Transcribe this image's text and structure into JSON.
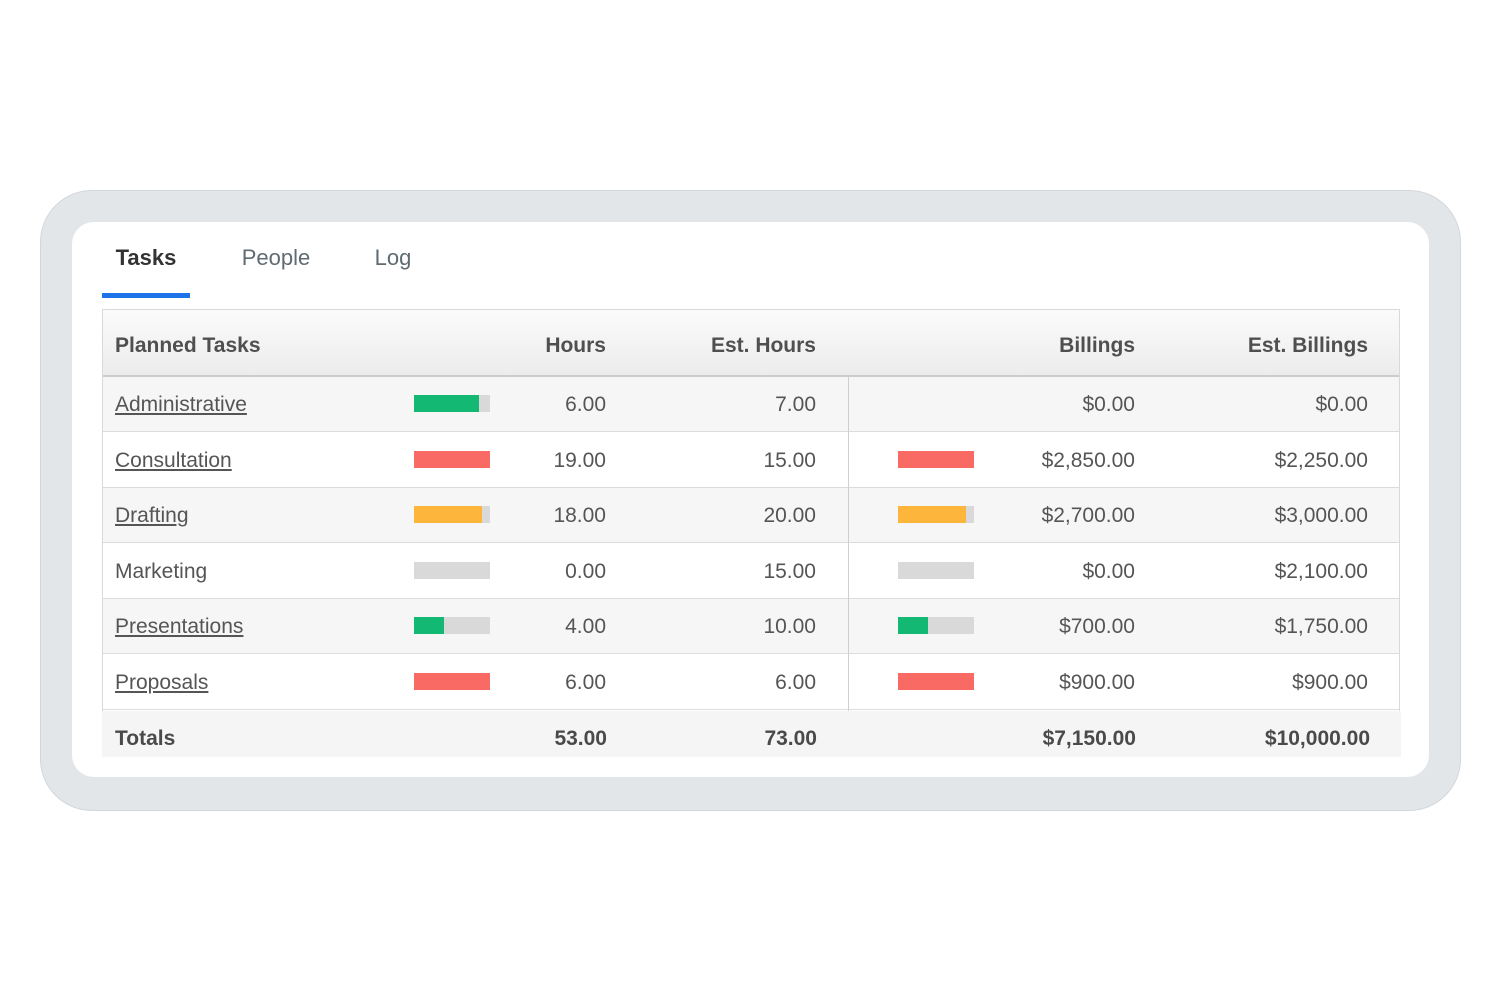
{
  "tabs": [
    {
      "label": "Tasks",
      "active": true
    },
    {
      "label": "People",
      "active": false
    },
    {
      "label": "Log",
      "active": false
    }
  ],
  "colors": {
    "accent": "#1e73e8",
    "green": "#13b873",
    "red": "#f96a65",
    "orange": "#fdb53c",
    "track": "#d9d9d9"
  },
  "table": {
    "headers": {
      "task": "Planned Tasks",
      "hours": "Hours",
      "est_hours": "Est. Hours",
      "billings": "Billings",
      "est_billings": "Est. Billings"
    },
    "rows": [
      {
        "task": "Administrative",
        "linked": true,
        "hours": "6.00",
        "est_hours": "7.00",
        "billings": "$0.00",
        "est_billings": "$0.00",
        "hours_bar": {
          "fraction": 0.857,
          "color": "green"
        },
        "billings_bar": null
      },
      {
        "task": "Consultation",
        "linked": true,
        "hours": "19.00",
        "est_hours": "15.00",
        "billings": "$2,850.00",
        "est_billings": "$2,250.00",
        "hours_bar": {
          "fraction": 1.0,
          "color": "red"
        },
        "billings_bar": {
          "fraction": 1.0,
          "color": "red"
        }
      },
      {
        "task": "Drafting",
        "linked": true,
        "hours": "18.00",
        "est_hours": "20.00",
        "billings": "$2,700.00",
        "est_billings": "$3,000.00",
        "hours_bar": {
          "fraction": 0.9,
          "color": "orange"
        },
        "billings_bar": {
          "fraction": 0.9,
          "color": "orange"
        }
      },
      {
        "task": "Marketing",
        "linked": false,
        "hours": "0.00",
        "est_hours": "15.00",
        "billings": "$0.00",
        "est_billings": "$2,100.00",
        "hours_bar": {
          "fraction": 0.0,
          "color": "green"
        },
        "billings_bar": {
          "fraction": 0.0,
          "color": "green"
        }
      },
      {
        "task": "Presentations",
        "linked": true,
        "hours": "4.00",
        "est_hours": "10.00",
        "billings": "$700.00",
        "est_billings": "$1,750.00",
        "hours_bar": {
          "fraction": 0.4,
          "color": "green"
        },
        "billings_bar": {
          "fraction": 0.4,
          "color": "green"
        }
      },
      {
        "task": "Proposals",
        "linked": true,
        "hours": "6.00",
        "est_hours": "6.00",
        "billings": "$900.00",
        "est_billings": "$900.00",
        "hours_bar": {
          "fraction": 1.0,
          "color": "red"
        },
        "billings_bar": {
          "fraction": 1.0,
          "color": "red"
        }
      }
    ],
    "totals": {
      "label": "Totals",
      "hours": "53.00",
      "est_hours": "73.00",
      "billings": "$7,150.00",
      "est_billings": "$10,000.00"
    }
  }
}
